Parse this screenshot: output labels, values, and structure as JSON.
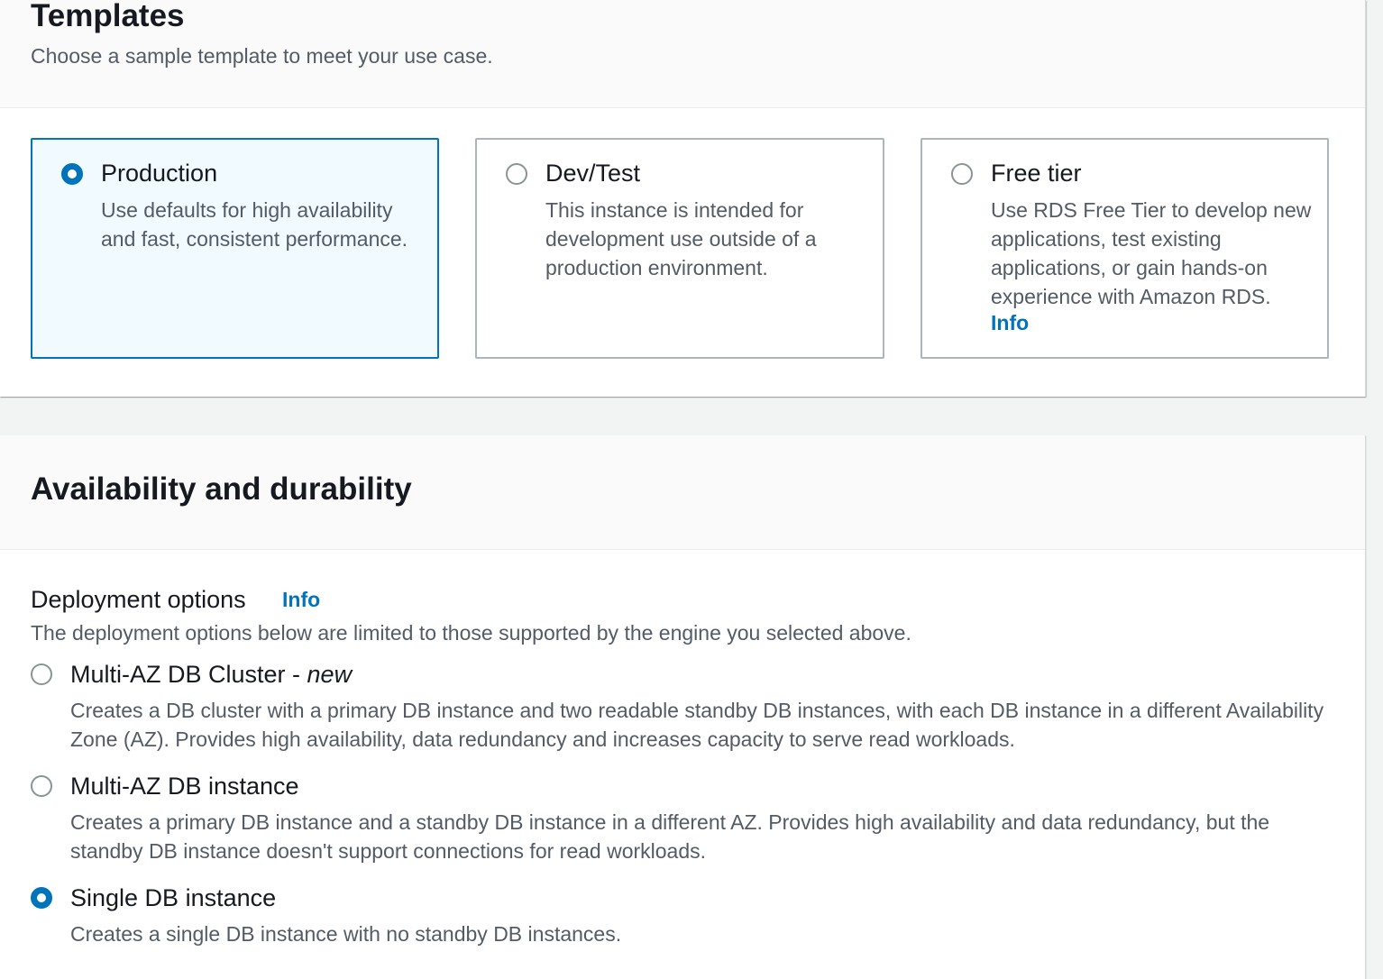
{
  "templates": {
    "title": "Templates",
    "description": "Choose a sample template to meet your use case.",
    "options": [
      {
        "title": "Production",
        "description": "Use defaults for high availability and fast, consistent performance.",
        "selected": true
      },
      {
        "title": "Dev/Test",
        "description": "This instance is intended for development use outside of a production environment.",
        "selected": false
      },
      {
        "title": "Free tier",
        "description": "Use RDS Free Tier to develop new applications, test existing applications, or gain hands-on experience with Amazon RDS.",
        "info": "Info",
        "selected": false
      }
    ]
  },
  "availability": {
    "title": "Availability and durability",
    "deployment_label": "Deployment options",
    "deployment_info": "Info",
    "deployment_description": "The deployment options below are limited to those supported by the engine you selected above.",
    "options": [
      {
        "title": "Multi-AZ DB Cluster - ",
        "title_suffix": "new",
        "description": "Creates a DB cluster with a primary DB instance and two readable standby DB instances, with each DB instance in a different Availability Zone (AZ). Provides high availability, data redundancy and increases capacity to serve read workloads.",
        "selected": false
      },
      {
        "title": "Multi-AZ DB instance",
        "description": "Creates a primary DB instance and a standby DB instance in a different AZ. Provides high availability and data redundancy, but the standby DB instance doesn't support connections for read workloads.",
        "selected": false
      },
      {
        "title": "Single DB instance",
        "description": "Creates a single DB instance with no standby DB instances.",
        "selected": true
      }
    ]
  },
  "colors": {
    "accent": "#0073bb",
    "text": "#16191f",
    "secondary_text": "#545b64"
  }
}
